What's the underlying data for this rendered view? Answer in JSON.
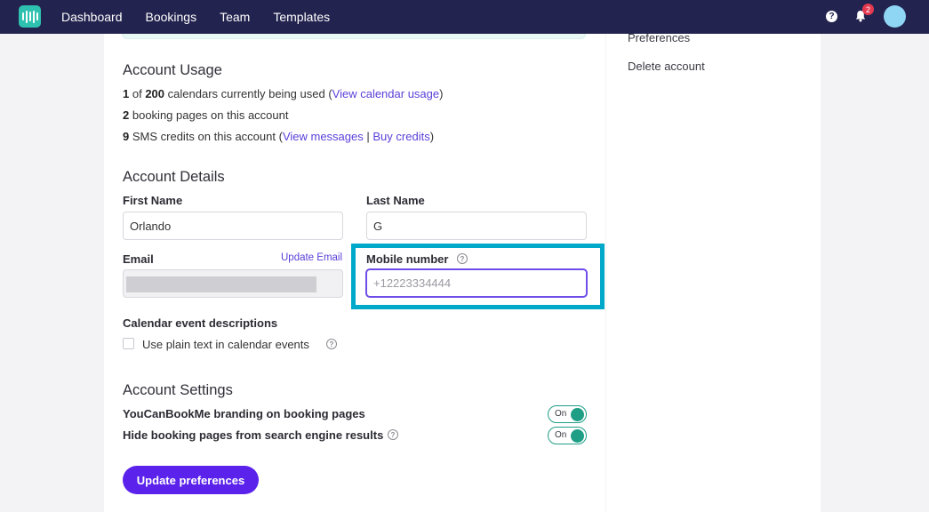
{
  "nav": {
    "items": [
      "Dashboard",
      "Bookings",
      "Team",
      "Templates"
    ],
    "help_label": "?",
    "notification_count": "2"
  },
  "side": {
    "preferences": "Preferences",
    "delete_account": "Delete account"
  },
  "usage": {
    "title": "Account Usage",
    "calendars_used": "1",
    "calendars_of": "of",
    "calendars_total": "200",
    "calendars_text": "calendars currently being used (",
    "calendars_link": "View calendar usage",
    "calendars_close": ")",
    "booking_pages_count": "2",
    "booking_pages_text": "booking pages on this account",
    "sms_count": "9",
    "sms_text": "SMS credits on this account (",
    "sms_view_link": "View messages",
    "sms_sep": "|",
    "sms_buy_link": "Buy credits",
    "sms_close": ")"
  },
  "details": {
    "title": "Account Details",
    "first_name_label": "First Name",
    "first_name_value": "Orlando",
    "last_name_label": "Last Name",
    "last_name_value": "G",
    "email_label": "Email",
    "update_email": "Update Email",
    "mobile_label": "Mobile number",
    "mobile_placeholder": "+12223334444",
    "calendar_desc_label": "Calendar event descriptions",
    "plain_text_label": "Use plain text in calendar events",
    "help_mark": "?"
  },
  "settings": {
    "title": "Account Settings",
    "branding_label": "YouCanBookMe branding on booking pages",
    "branding_state": "On",
    "hide_label": "Hide booking pages from search engine results",
    "hide_state": "On"
  },
  "actions": {
    "update_preferences": "Update preferences"
  },
  "colors": {
    "nav_bg": "#23234f",
    "accent": "#5a22ea",
    "link": "#5b3fd9",
    "toggle_on": "#1f9e86",
    "highlight": "#00a8c9"
  }
}
